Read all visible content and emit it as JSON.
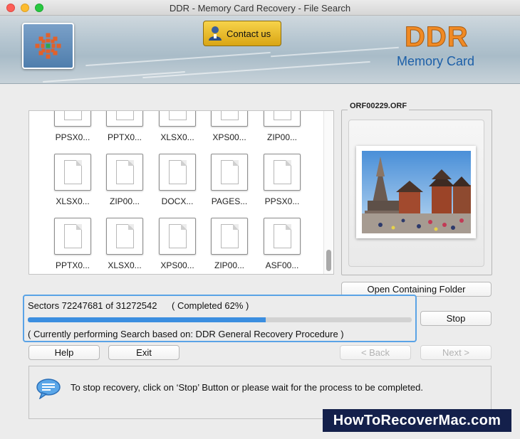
{
  "window": {
    "title": "DDR - Memory Card Recovery - File Search"
  },
  "header": {
    "contact_label": "Contact us",
    "brand_title": "DDR",
    "brand_subtitle": "Memory Card"
  },
  "files": [
    {
      "label": "PPSX0..."
    },
    {
      "label": "PPTX0..."
    },
    {
      "label": "XLSX0..."
    },
    {
      "label": "XPS00..."
    },
    {
      "label": "ZIP00..."
    },
    {
      "label": "XLSX0..."
    },
    {
      "label": "ZIP00..."
    },
    {
      "label": "DOCX..."
    },
    {
      "label": "PAGES..."
    },
    {
      "label": "PPSX0..."
    },
    {
      "label": "PPTX0..."
    },
    {
      "label": "XLSX0..."
    },
    {
      "label": "XPS00..."
    },
    {
      "label": "ZIP00..."
    },
    {
      "label": "ASF00..."
    }
  ],
  "preview": {
    "filename": "ORF00229.ORF",
    "open_folder_label": "Open Containing Folder"
  },
  "progress": {
    "sectors_text": "Sectors 72247681 of 31272542",
    "completed_text": "( Completed 62% )",
    "percent": 62,
    "status_text": "( Currently performing Search based on: DDR General Recovery Procedure )",
    "stop_label": "Stop"
  },
  "footer_buttons": {
    "help": "Help",
    "exit": "Exit",
    "back": "< Back",
    "next": "Next >"
  },
  "message": "To stop recovery, click on ‘Stop’ Button or please wait for the process to be completed.",
  "watermark": "HowToRecoverMac.com",
  "colors": {
    "accent": "#3b8ee0",
    "brand_orange": "#f08a24",
    "brand_blue": "#1c5fa8",
    "contact_gold": "#f0c232"
  }
}
